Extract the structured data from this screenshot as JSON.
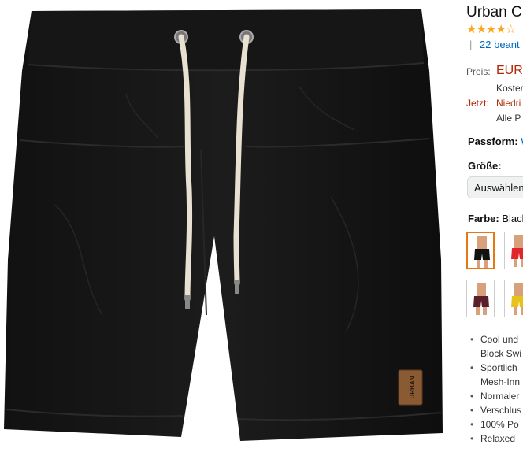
{
  "product": {
    "title": "Urban Cl",
    "stars_glyphs": "★★★★☆",
    "rating_separator": "|",
    "ratings_link": "22 beant"
  },
  "price": {
    "label": "Preis:",
    "value": "EUR",
    "shipping": "Koster",
    "now_label": "Jetzt:",
    "now_value": "Niedri",
    "all_prices": "Alle P"
  },
  "fit": {
    "label": "Passform:",
    "value": "W"
  },
  "size": {
    "label": "Größe:",
    "select_value": "Auswählen"
  },
  "color": {
    "label": "Farbe:",
    "value": "Black"
  },
  "swatches": [
    {
      "color": "black",
      "selected": true
    },
    {
      "color": "red",
      "selected": false
    },
    {
      "color": "burgundy",
      "selected": false
    },
    {
      "color": "yellow",
      "selected": false
    }
  ],
  "bullets": [
    "Cool und",
    "Block Swi",
    "Sportlich",
    "Mesh-Inn",
    "Normaler",
    "Verschlus",
    "100% Po",
    "Relaxed"
  ],
  "product_image": {
    "label_patch_text": "URBAN"
  }
}
